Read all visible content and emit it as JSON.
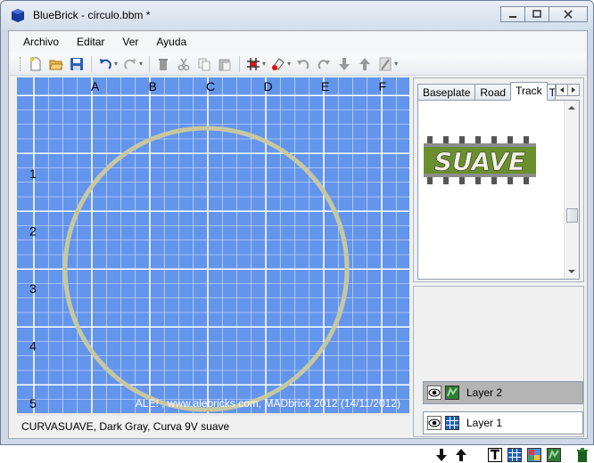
{
  "window": {
    "title": "BlueBrick - círculo.bbm *",
    "minimize": "—",
    "maximize": "▢",
    "close": "✕"
  },
  "menu": [
    "Archivo",
    "Editar",
    "Ver",
    "Ayuda"
  ],
  "map": {
    "columns": [
      "A",
      "B",
      "C",
      "D",
      "E",
      "F"
    ],
    "rows": [
      "1",
      "2",
      "3",
      "4",
      "5"
    ],
    "background_color": "#6495ed",
    "grid_color": "#ffffff",
    "circle_color": "#c8c8a0",
    "watermark": "ALE! , www.alebricks.com, MADbrick 2012 (14/11/2012)"
  },
  "status": "CURVASUAVE, Dark Gray, Curva 9V suave",
  "part_library": {
    "tabs": [
      "Baseplate",
      "Road",
      "Track",
      "T"
    ],
    "active_tab": "Track",
    "part_label": "SUAVE"
  },
  "layers": {
    "items": [
      {
        "name": "Layer 2",
        "type": "area",
        "selected": true
      },
      {
        "name": "Layer 1",
        "type": "grid",
        "selected": false
      }
    ]
  },
  "icons": {
    "toolbar": [
      "new-file-icon",
      "open-folder-icon",
      "save-icon",
      "undo-icon",
      "redo-icon",
      "delete-icon",
      "cut-icon",
      "copy-icon",
      "paste-icon",
      "snap-grid-icon",
      "paint-icon",
      "rotate-left-icon",
      "rotate-right-icon",
      "send-back-icon",
      "bring-front-icon",
      "ruler-icon"
    ]
  }
}
